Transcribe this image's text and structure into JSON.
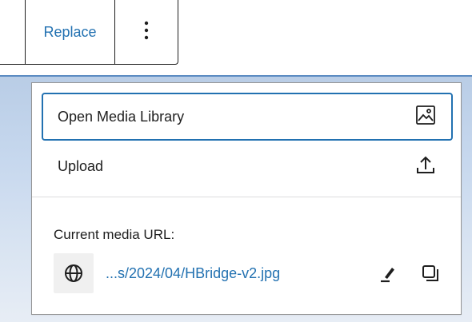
{
  "toolbar": {
    "replace_label": "Replace"
  },
  "menu": {
    "items": [
      {
        "label": "Open Media Library",
        "icon": "media-library-icon"
      },
      {
        "label": "Upload",
        "icon": "upload-icon"
      }
    ]
  },
  "current_media": {
    "label": "Current media URL:",
    "url_display": "...s/2024/04/HBridge-v2.jpg"
  },
  "colors": {
    "accent": "#2271b1",
    "text": "#1e1e1e",
    "border": "#949494"
  }
}
